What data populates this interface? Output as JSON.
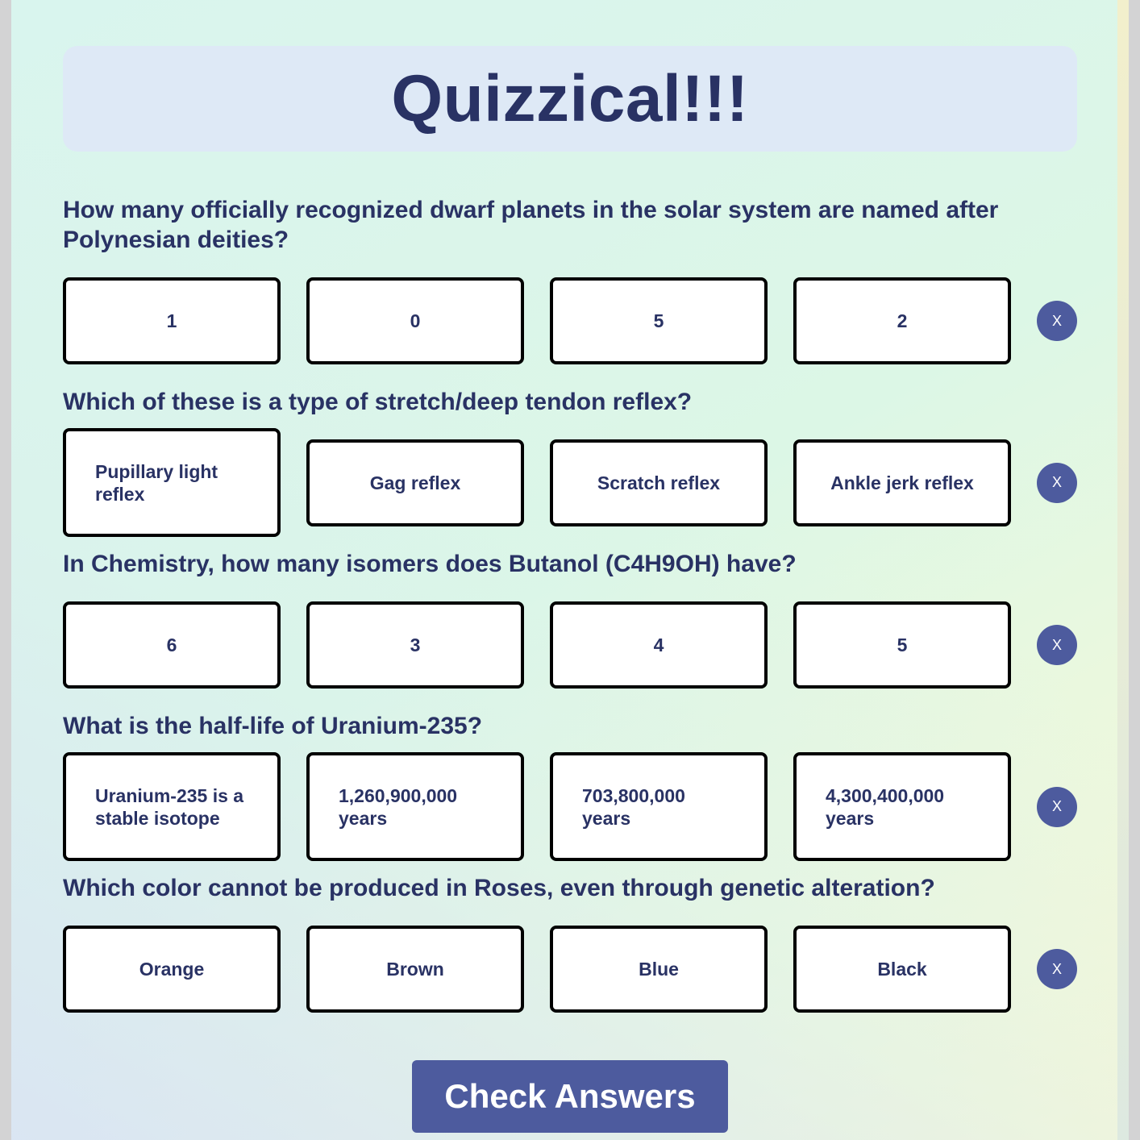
{
  "app": {
    "title": "Quizzical!!!"
  },
  "questions": [
    {
      "text": "How many officially recognized dwarf planets in the solar system are named after Polynesian deities?",
      "answers": [
        "1",
        "0",
        "5",
        "2"
      ],
      "clear_label": "X"
    },
    {
      "text": "Which of these is a type of stretch/deep tendon reflex?",
      "answers": [
        "Pupillary light reflex",
        "Gag reflex",
        "Scratch reflex",
        "Ankle jerk reflex"
      ],
      "clear_label": "X"
    },
    {
      "text": "In Chemistry, how many isomers does Butanol (C4H9OH) have?",
      "answers": [
        "6",
        "3",
        "4",
        "5"
      ],
      "clear_label": "X"
    },
    {
      "text": "What is the half-life of Uranium-235?",
      "answers": [
        "Uranium-235 is a stable isotope",
        "1,260,900,000 years",
        "703,800,000 years",
        "4,300,400,000 years"
      ],
      "clear_label": "X"
    },
    {
      "text": "Which color cannot be produced in Roses, even through genetic alteration?",
      "answers": [
        "Orange",
        "Brown",
        "Blue",
        "Black"
      ],
      "clear_label": "X"
    }
  ],
  "footer": {
    "check_label": "Check Answers"
  },
  "colors": {
    "primary": "#4d5b9e",
    "text": "#293264",
    "header_bg": "#dee9f6"
  }
}
